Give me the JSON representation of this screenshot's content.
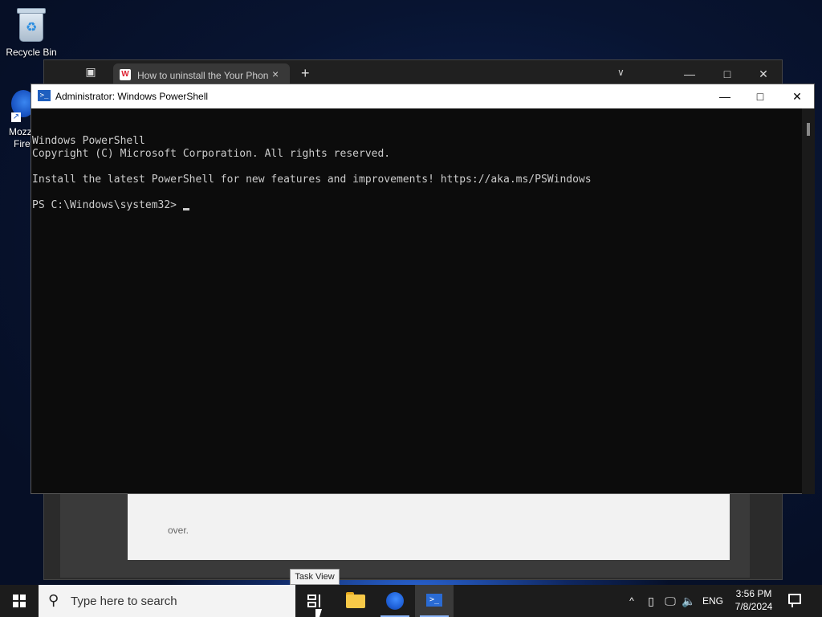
{
  "desktop": {
    "recycle_bin_label": "Recycle Bin",
    "firefox_label_line1": "Mozz",
    "firefox_label_line2": "Firef"
  },
  "browser": {
    "tab_title": "How to uninstall the Your Phon",
    "tab_close": "×",
    "new_tab": "+",
    "tab_list": "∨",
    "minimize": "—",
    "maximize": "□",
    "close": "✕",
    "page_text": "over."
  },
  "powershell": {
    "title": "Administrator: Windows PowerShell",
    "minimize": "—",
    "maximize": "□",
    "close": "✕",
    "lines": [
      "Windows PowerShell",
      "Copyright (C) Microsoft Corporation. All rights reserved.",
      "",
      "Install the latest PowerShell for new features and improvements! https://aka.ms/PSWindows",
      "",
      "PS C:\\Windows\\system32> "
    ]
  },
  "tooltip": "Task View",
  "taskbar": {
    "search_placeholder": "Type here to search",
    "pinned": [
      "task-view",
      "file-explorer",
      "firefox",
      "powershell"
    ],
    "tray": {
      "overflow": "^",
      "language": "ENG",
      "time": "3:56 PM",
      "date": "7/8/2024"
    }
  },
  "colors": {
    "console_bg": "#0c0c0c",
    "console_text": "#cccccc",
    "taskbar_bg": "#1c1c1c",
    "accent": "#2a6bd4"
  }
}
